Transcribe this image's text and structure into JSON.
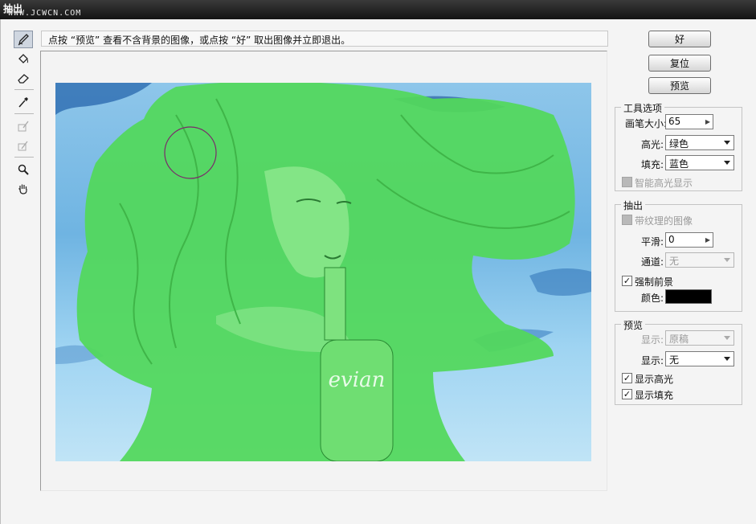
{
  "window": {
    "title": "抽出",
    "watermark": "WWW.JCWCN.COM"
  },
  "hint": "点按 “预览” 查看不含背景的图像，或点按 “好” 取出图像并立即退出。",
  "buttons": {
    "ok": "好",
    "reset": "复位",
    "preview": "预览"
  },
  "tools": [
    "edge-highlighter-icon",
    "fill-icon",
    "eraser-icon",
    "eyedropper-icon",
    "cleanup-icon",
    "edge-touchup-icon",
    "zoom-icon",
    "hand-icon"
  ],
  "tool_options": {
    "title": "工具选项",
    "brush_size_label": "画笔大小:",
    "brush_size_value": "65",
    "highlight_label": "高光:",
    "highlight_value": "绿色",
    "fill_label": "填充:",
    "fill_value": "蓝色",
    "smart_highlight_label": "智能高光显示",
    "smart_highlight_checked": false
  },
  "extraction": {
    "title": "抽出",
    "textured_label": "带纹理的图像",
    "textured_checked": false,
    "smooth_label": "平滑:",
    "smooth_value": "0",
    "channel_label": "通道:",
    "channel_value": "无",
    "force_fg_label": "强制前景",
    "force_fg_checked": true,
    "color_label": "颜色:",
    "color_value": "#000000"
  },
  "preview": {
    "title": "预览",
    "show1_label": "显示:",
    "show1_value": "原稿",
    "show2_label": "显示:",
    "show2_value": "无",
    "show_highlight_label": "显示高光",
    "show_highlight_checked": true,
    "show_fill_label": "显示填充",
    "show_fill_checked": true
  },
  "canvas": {
    "bottle_text": "evian",
    "highlight_color": "#52d85a",
    "water_color": "#7dbfe8"
  }
}
